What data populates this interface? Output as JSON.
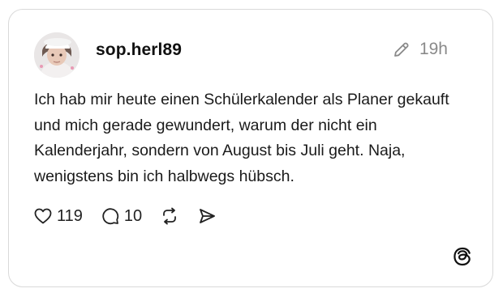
{
  "post": {
    "username": "sop.herl89",
    "time": "19h",
    "text": "Ich hab mir heute einen Schülerkalender als Planer gekauft und mich gerade gewundert, warum der nicht ein Kalenderjahr, sondern von August bis Juli geht. Naja, wenigstens bin ich halbwegs hübsch."
  },
  "actions": {
    "likes": "119",
    "replies": "10"
  },
  "icons": [
    "pencil-icon",
    "heart-icon",
    "comment-icon",
    "repost-icon",
    "send-icon",
    "threads-logo-icon"
  ]
}
